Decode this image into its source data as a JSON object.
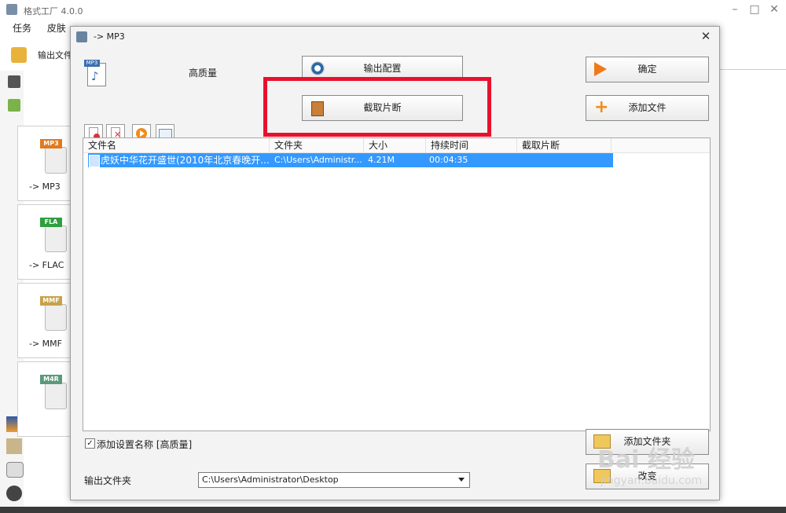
{
  "main_window": {
    "title": "格式工厂 4.0.0",
    "menu": [
      "任务",
      "皮肤"
    ],
    "toolbar_label": "输出文件",
    "formats": [
      {
        "tag": "MP3",
        "label": "-> MP3",
        "color": "#e07a1f"
      },
      {
        "tag": "FLA",
        "label": "-> FLAC",
        "color": "#2e9e3e"
      },
      {
        "tag": "MMF",
        "label": "-> MMF",
        "color": "#c8a24a"
      },
      {
        "tag": "M4R",
        "label": "",
        "color": "#5a9a7a"
      }
    ]
  },
  "dialog": {
    "title": "-> MP3",
    "quality_label": "高质量",
    "buttons": {
      "output_config": "输出配置",
      "clip": "截取片断",
      "ok": "确定",
      "add_file": "添加文件",
      "add_folder": "添加文件夹",
      "change": "改变"
    },
    "columns": [
      "文件名",
      "文件夹",
      "大小",
      "持续时间",
      "截取片断"
    ],
    "rows": [
      {
        "name": "虎妖中华花开盛世(2010年北京春晚开...",
        "folder": "C:\\Users\\Administr...",
        "size": "4.21M",
        "duration": "00:04:35",
        "clip": ""
      }
    ],
    "checkbox_label": "添加设置名称 [高质量]",
    "output_folder_label": "输出文件夹",
    "output_path": "C:\\Users\\Administrator\\Desktop"
  },
  "watermark": {
    "main": "Bai 经验",
    "sub": "jingyan.baidu.com"
  }
}
